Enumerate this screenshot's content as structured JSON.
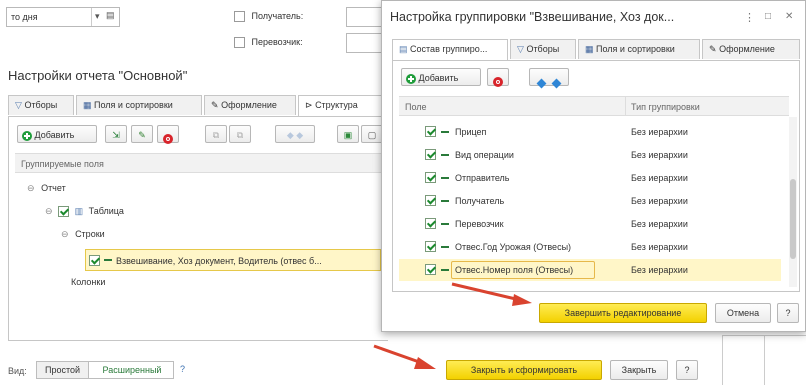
{
  "top_filters": {
    "period_value": "то дня",
    "recipient_label": "Получатель:",
    "carrier_label": "Перевозчик:"
  },
  "settings_panel": {
    "title": "Настройки отчета \"Основной\"",
    "tabs": [
      "Отборы",
      "Поля и сортировки",
      "Оформление",
      "Структура"
    ],
    "active_tab": "Структура",
    "add_label": "Добавить",
    "column_header": "Группируемые поля",
    "tree": {
      "report": "Отчет",
      "table": "Таблица",
      "rows": "Строки",
      "grouping": "Взвешивание, Хоз документ, Водитель (отвес б...",
      "columns": "Колонки"
    }
  },
  "bottom_bar": {
    "view_label": "Вид:",
    "simple": "Простой",
    "advanced": "Расширенный",
    "help": "?",
    "close_generate": "Закрыть и сформировать",
    "close": "Закрыть",
    "question": "?"
  },
  "dialog": {
    "title": "Настройка группировки \"Взвешивание, Хоз док...",
    "tabs": [
      "Состав группиро...",
      "Отборы",
      "Поля и сортировки",
      "Оформление"
    ],
    "add_label": "Добавить",
    "col_field": "Поле",
    "col_type": "Тип группировки",
    "rows": [
      {
        "field": "Прицеп",
        "type": "Без иерархии"
      },
      {
        "field": "Вид операции",
        "type": "Без иерархии"
      },
      {
        "field": "Отправитель",
        "type": "Без иерархии"
      },
      {
        "field": "Получатель",
        "type": "Без иерархии"
      },
      {
        "field": "Перевозчик",
        "type": "Без иерархии"
      },
      {
        "field": "Отвес.Год Урожая (Отвесы)",
        "type": "Без иерархии"
      },
      {
        "field": "Отвес.Номер поля (Отвесы)",
        "type": "Без иерархии"
      }
    ],
    "finish": "Завершить редактирование",
    "cancel": "Отмена",
    "help": "?",
    "window_controls": [
      "⋮",
      "□",
      "✕"
    ]
  },
  "colors": {
    "accent_yellow": "#f3d100",
    "arrow_red": "#d9432f",
    "highlight": "#fff6c8"
  }
}
